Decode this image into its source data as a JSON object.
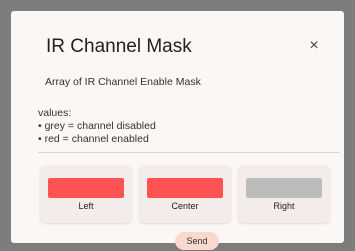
{
  "dialog": {
    "title": "IR Channel Mask",
    "close_glyph": "×",
    "close_icon": "close-icon",
    "subtitle": "Array of IR Channel Enable Mask",
    "values_heading": "values:",
    "legend_grey": "• grey = channel disabled",
    "legend_red": "• red = channel enabled"
  },
  "channels": [
    {
      "label": "Left",
      "state": "enabled",
      "color": "#ff5353"
    },
    {
      "label": "Center",
      "state": "enabled",
      "color": "#ff5353"
    },
    {
      "label": "Right",
      "state": "disabled",
      "color": "#bcbcbc"
    }
  ],
  "actions": {
    "send_label": "Send"
  },
  "colors": {
    "overlay": "#7d7d7d",
    "dialog_bg": "#fbf7f5",
    "enabled": "#ff5353",
    "disabled": "#bcbcbc",
    "send_button": "#f9d9cd"
  }
}
